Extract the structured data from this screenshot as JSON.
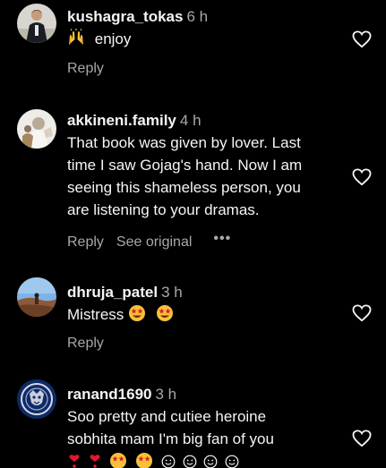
{
  "comments": [
    {
      "username": "kushagra_tokas",
      "time": "6 h",
      "text": "enjoy",
      "reply": "Reply"
    },
    {
      "username": "akkineni.family",
      "time": "4 h",
      "text_lines": [
        "That book was given by lover. Last",
        "time I saw Gojag's hand. Now I am",
        "seeing this shameless person, you",
        "are listening to your dramas."
      ],
      "reply": "Reply",
      "see_original": "See original",
      "more": "•••"
    },
    {
      "username": "dhruja_patel",
      "time": "3 h",
      "text": "Mistress",
      "reply": "Reply"
    },
    {
      "username": "ranand1690",
      "time": "3 h",
      "text_lines": [
        "Soo pretty and cutiee heroine",
        "sobhita mam I'm big fan of you"
      ]
    }
  ],
  "icons": {
    "like": "heart-outline-icon",
    "raised_hands": "raising-hands-emoji",
    "star_eyes": "star-struck-emoji",
    "heart_exclamation": "heart-exclamation-emoji",
    "smile": "smiling-face-emoji"
  },
  "colors": {
    "background": "#000000",
    "primary_text": "#f5f5f5",
    "secondary_text": "#a8a8a8",
    "emoji_yellow": "#f7c137",
    "emoji_red": "#e0182d"
  }
}
